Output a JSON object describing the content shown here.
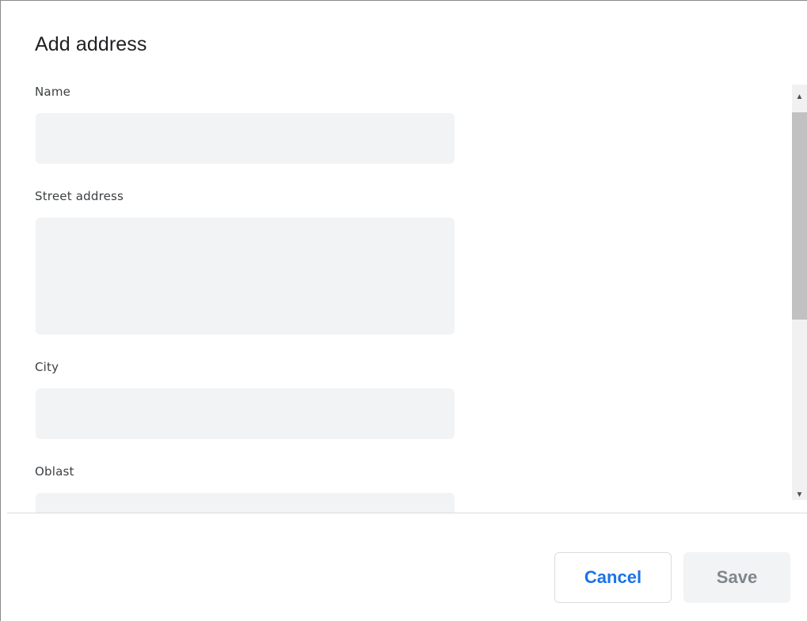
{
  "dialog": {
    "title": "Add address"
  },
  "form": {
    "fields": [
      {
        "label": "Name",
        "value": "",
        "placeholder": ""
      },
      {
        "label": "Street address",
        "value": "",
        "placeholder": ""
      },
      {
        "label": "City",
        "value": "",
        "placeholder": ""
      },
      {
        "label": "Oblast",
        "value": "",
        "placeholder": ""
      }
    ]
  },
  "scrollbar": {
    "up_arrow": "▲",
    "down_arrow": "▼"
  },
  "footer": {
    "cancel_label": "Cancel",
    "save_label": "Save"
  },
  "colors": {
    "accent": "#1a73e8",
    "input_background": "#f1f3f4",
    "disabled_text": "#80868b",
    "divider": "#dadce0"
  }
}
